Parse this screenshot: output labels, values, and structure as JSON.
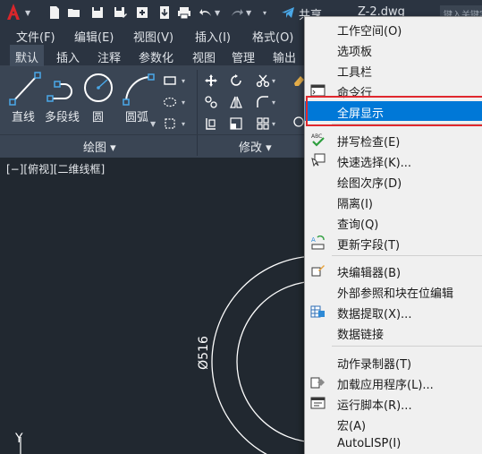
{
  "title_bar": {
    "share_label": "共享",
    "document_title": "Z-2.dwg",
    "search_placeholder": "键入关键字"
  },
  "menu_bar": [
    "文件(F)",
    "编辑(E)",
    "视图(V)",
    "插入(I)",
    "格式(O)"
  ],
  "ribbon_tabs": [
    "默认",
    "插入",
    "注释",
    "参数化",
    "视图",
    "管理",
    "输出"
  ],
  "ribbon": {
    "draw_tools": [
      "直线",
      "多段线",
      "圆",
      "圆弧"
    ],
    "draw_panel_title": "绘图 ▾",
    "modify_panel_title": "修改 ▾"
  },
  "viewport": {
    "label": "[−][俯视][二维线框]",
    "dimension_text": "Ø516",
    "axis_label": "Y"
  },
  "context_menu": {
    "items": [
      {
        "label": "工作空间(O)",
        "icon": ""
      },
      {
        "label": "选项板",
        "icon": ""
      },
      {
        "label": "工具栏",
        "icon": ""
      },
      {
        "label": "命令行",
        "icon": "command-line-icon"
      },
      {
        "label": "全屏显示",
        "icon": "",
        "highlighted": true
      },
      {
        "label": "拼写检查(E)",
        "icon": "spell-check-icon"
      },
      {
        "label": "快速选择(K)...",
        "icon": "quick-select-icon"
      },
      {
        "label": "绘图次序(D)",
        "icon": ""
      },
      {
        "label": "隔离(I)",
        "icon": ""
      },
      {
        "label": "查询(Q)",
        "icon": ""
      },
      {
        "label": "更新字段(T)",
        "icon": "update-field-icon"
      },
      {
        "label": "块编辑器(B)",
        "icon": "block-editor-icon"
      },
      {
        "label": "外部参照和块在位编辑",
        "icon": ""
      },
      {
        "label": "数据提取(X)...",
        "icon": "data-extract-icon"
      },
      {
        "label": "数据链接",
        "icon": ""
      },
      {
        "label": "动作录制器(T)",
        "icon": ""
      },
      {
        "label": "加载应用程序(L)...",
        "icon": "load-app-icon"
      },
      {
        "label": "运行脚本(R)...",
        "icon": "run-script-icon"
      },
      {
        "label": "宏(A)",
        "icon": ""
      },
      {
        "label": "AutoLISP(I)",
        "icon": ""
      }
    ]
  },
  "colors": {
    "highlight": "#0078d7",
    "callout_frame": "#e0282e",
    "ribbon_bg": "#3a4554",
    "canvas_bg": "#212830"
  }
}
